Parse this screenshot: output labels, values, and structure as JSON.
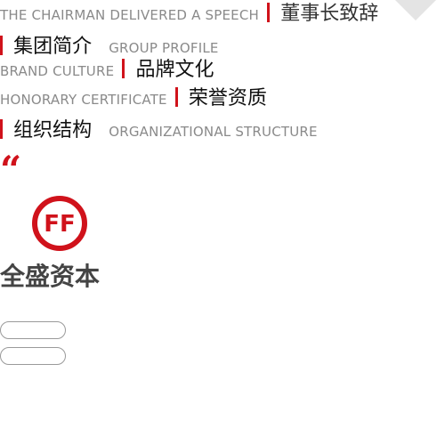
{
  "menu": {
    "chairman_speech": {
      "en": "THE CHAIRMAN DELIVERED A SPEECH",
      "zh": "董事长致辞"
    },
    "group_profile": {
      "zh": "集团简介",
      "en": "GROUP PROFILE"
    },
    "brand_culture": {
      "en": "BRAND CULTURE",
      "zh": "品牌文化"
    },
    "honorary_certificate": {
      "en": "HONORARY CERTIFICATE",
      "zh": "荣誉资质"
    },
    "organizational_structure": {
      "zh": "组织结构",
      "en": "ORGANIZATIONAL STRUCTURE"
    }
  },
  "quote_mark": "“",
  "logo": {
    "monogram": "FF",
    "wordmark": "全盛资本"
  },
  "buttons": {
    "pill_1": "",
    "pill_2": ""
  },
  "colors": {
    "accent": "#d0121b",
    "english_text": "#8a8a8a",
    "chinese_text": "#111111",
    "wordmark": "#444444",
    "corner": "#e4e4e4"
  }
}
